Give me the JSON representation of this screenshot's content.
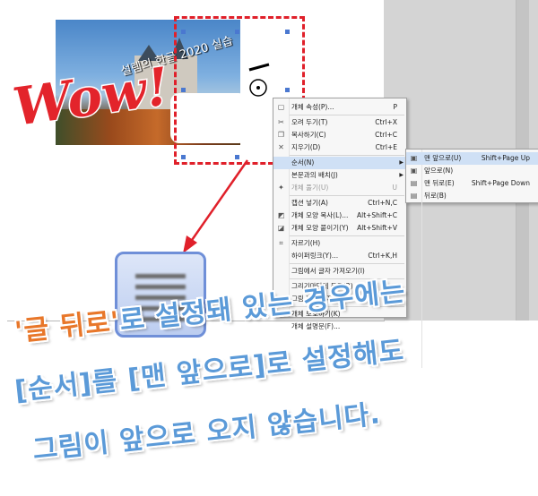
{
  "photo": {
    "caption": "설렘의 한글 2020 실습"
  },
  "wow": {
    "text": "Wow!"
  },
  "context_menu": {
    "items": [
      {
        "icon": "object-properties-icon",
        "label": "개체 속성(P)...",
        "shortcut": "P"
      },
      {
        "icon": "cut-icon",
        "label": "오려 두기(T)",
        "shortcut": "Ctrl+X"
      },
      {
        "icon": "copy-icon",
        "label": "복사하기(C)",
        "shortcut": "Ctrl+C"
      },
      {
        "icon": "delete-icon",
        "label": "지우기(D)",
        "shortcut": "Ctrl+E"
      },
      {
        "icon": "",
        "label": "순서(N)",
        "shortcut": "",
        "submenu": true,
        "highlighted": true
      },
      {
        "icon": "",
        "label": "본문과의 배치(J)",
        "shortcut": "",
        "submenu": true
      },
      {
        "icon": "ungroup-icon",
        "label": "개체 풀기(U)",
        "shortcut": "U",
        "disabled": true
      },
      {
        "icon": "",
        "label": "캡션 넣기(A)",
        "shortcut": "Ctrl+N,C"
      },
      {
        "icon": "copy-shape-icon",
        "label": "개체 모양 복사(L)...",
        "shortcut": "Alt+Shift+C"
      },
      {
        "icon": "paste-shape-icon",
        "label": "개체 모양 붙이기(Y)",
        "shortcut": "Alt+Shift+V"
      },
      {
        "icon": "crop-icon",
        "label": "자르기(H)",
        "shortcut": ""
      },
      {
        "icon": "",
        "label": "하이퍼링크(Y)...",
        "shortcut": "Ctrl+K,H"
      },
      {
        "icon": "",
        "label": "그림에서 글자 가져오기(I)",
        "shortcut": ""
      },
      {
        "icon": "",
        "label": "그리기마당에 등록(R)",
        "shortcut": ""
      },
      {
        "icon": "",
        "label": "그림 파일로 저장(S)",
        "shortcut": ""
      },
      {
        "icon": "",
        "label": "개체 보호하기(K)",
        "shortcut": ""
      },
      {
        "icon": "",
        "label": "개체 설명문(F)...",
        "shortcut": ""
      }
    ]
  },
  "submenu": {
    "items": [
      {
        "icon": "bring-to-front-icon",
        "label": "맨 앞으로(U)",
        "shortcut": "Shift+Page Up",
        "highlighted": true
      },
      {
        "icon": "bring-forward-icon",
        "label": "앞으로(N)",
        "shortcut": ""
      },
      {
        "icon": "send-to-back-icon",
        "label": "맨 뒤로(E)",
        "shortcut": "Shift+Page Down"
      },
      {
        "icon": "send-backward-icon",
        "label": "뒤로(B)",
        "shortcut": ""
      }
    ]
  },
  "big_icon": {
    "name": "behind-text-icon"
  },
  "caption": {
    "line1_quote_open": "'",
    "line1_hot": "글 뒤로",
    "line1_quote_close": "'",
    "line1_rest": "로 설정돼 있는 경우에는",
    "line2": "[순서]를 [맨 앞으로]로 설정해도",
    "line3": "그림이 앞으로 오지 않습니다."
  },
  "colors": {
    "accent_blue": "#5b9ad8",
    "accent_orange": "#e8772a",
    "selection_red": "#e0202a",
    "menu_highlight": "#cfe0f5"
  }
}
